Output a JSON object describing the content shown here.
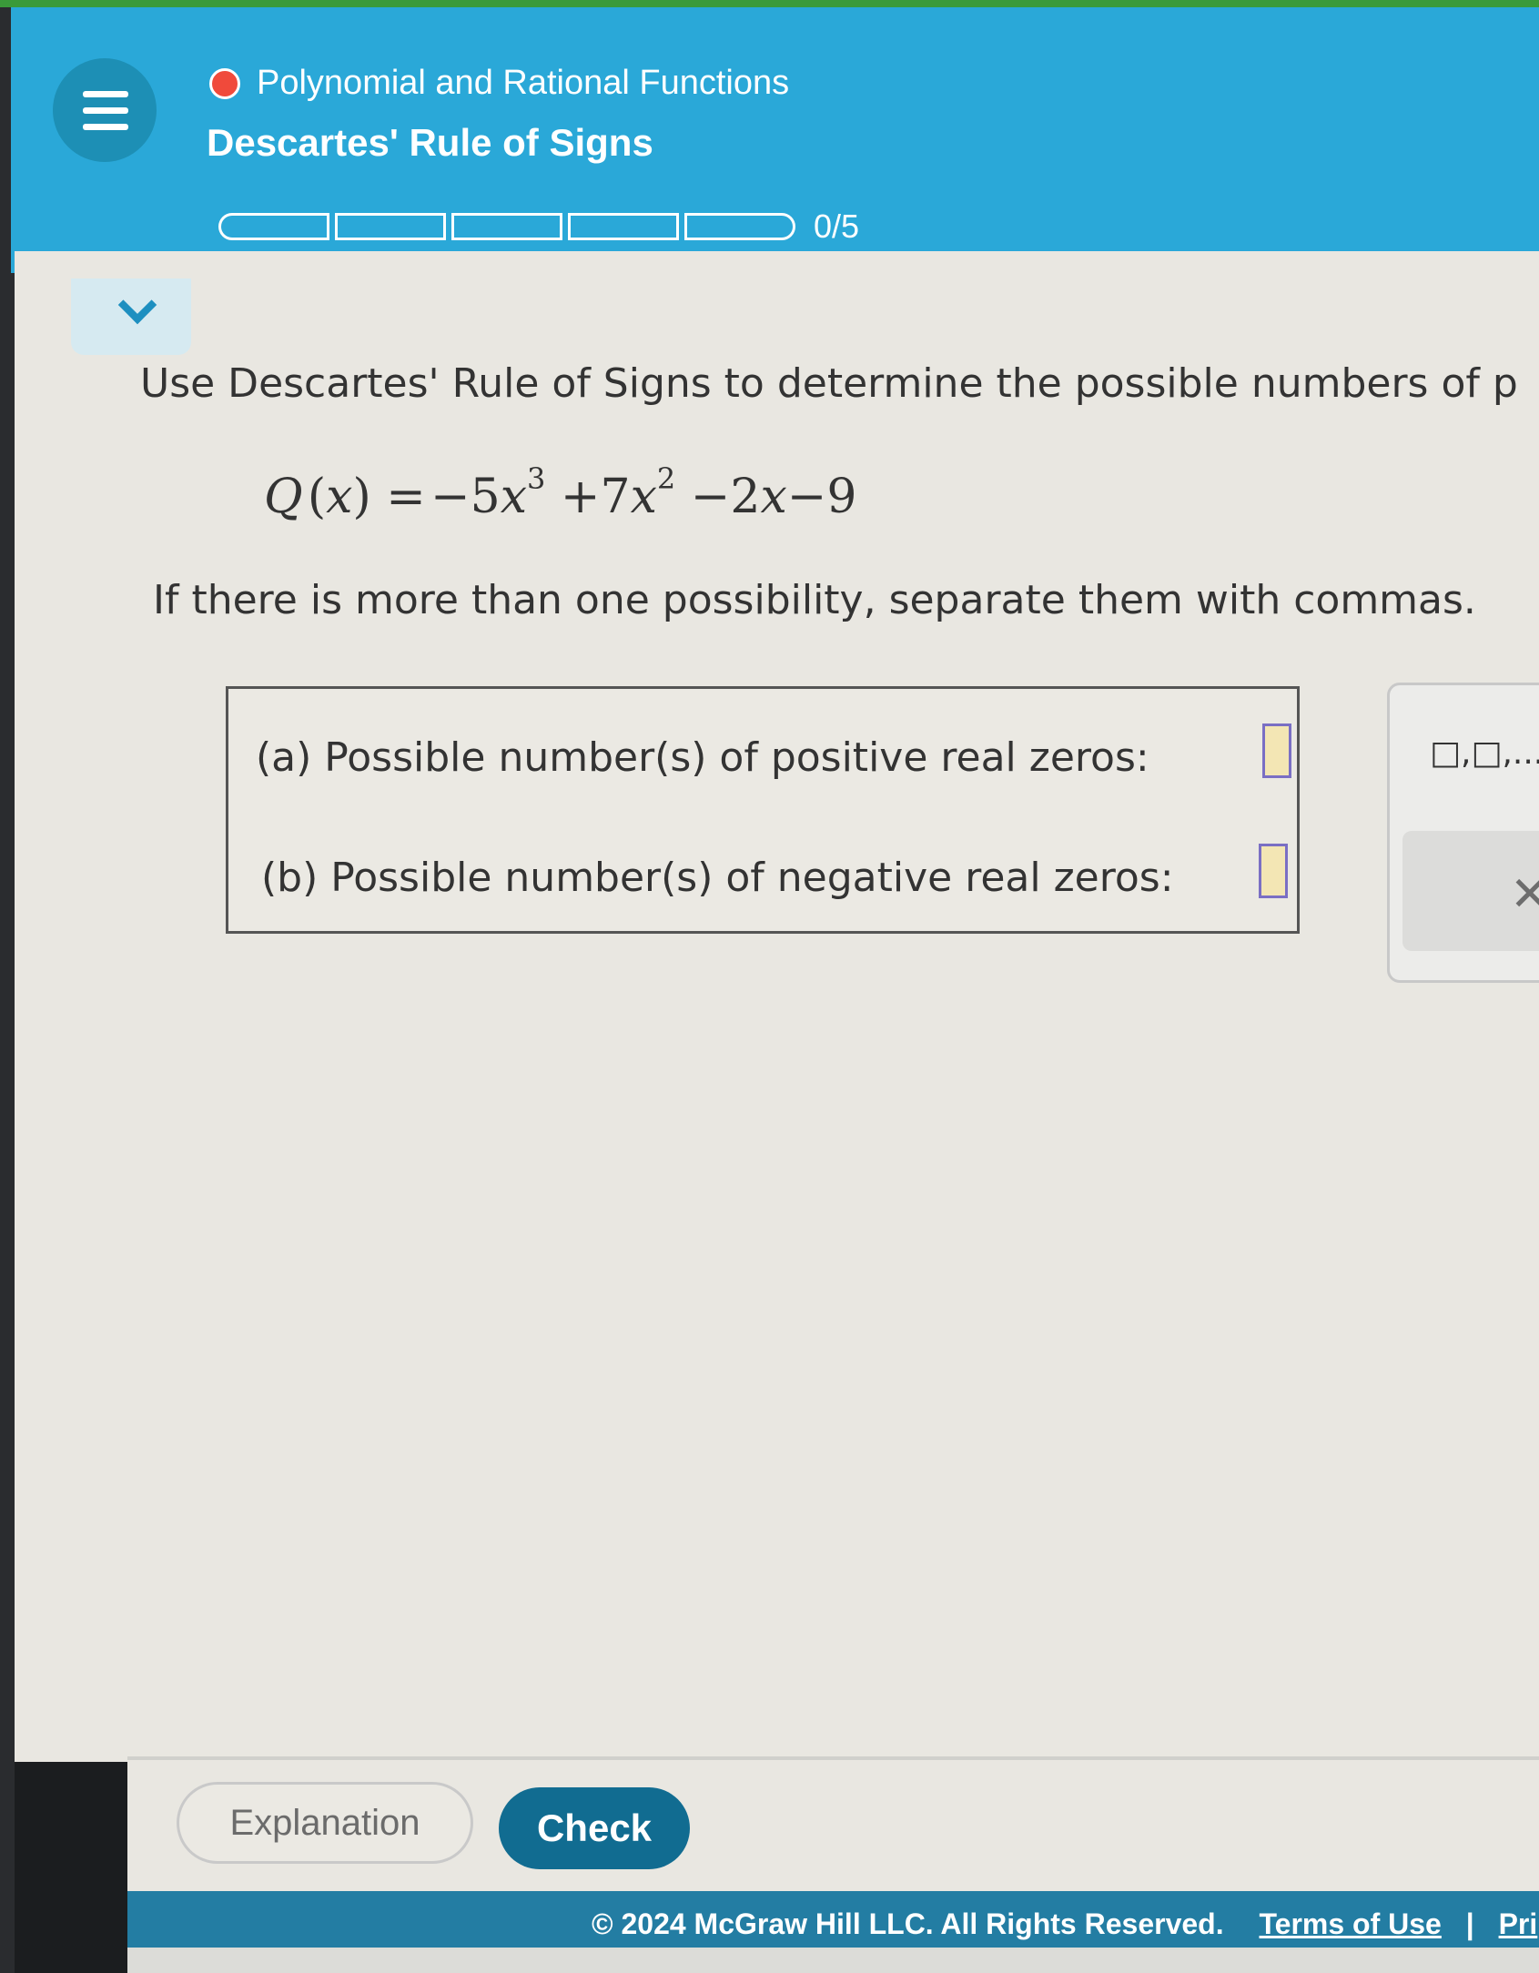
{
  "header": {
    "topic": "Polynomial and Rational Functions",
    "lesson_title": "Descartes' Rule of Signs",
    "progress_text": "0/5",
    "progress": {
      "completed": 0,
      "total": 5
    }
  },
  "question": {
    "instruction": "Use Descartes' Rule of Signs to determine the possible numbers of p",
    "equation": {
      "fname": "Q",
      "var": "x",
      "t1_sign": "−",
      "t1_coef": "5",
      "t1_var": "x",
      "t1_exp": "3",
      "t2_sign": "+",
      "t2_coef": "7",
      "t2_var": "x",
      "t2_exp": "2",
      "t3_sign": "−",
      "t3_coef": "2",
      "t3_var": "x",
      "t4_sign": "−",
      "t4_const": "9"
    },
    "separator_note": "If there is more than one possibility, separate them with commas.",
    "part_a_label": "(a) Possible number(s) of positive real zeros:",
    "part_b_label": "(b) Possible number(s) of negative real zeros:",
    "part_a_value": "",
    "part_b_value": ""
  },
  "palette": {
    "template_label": "□,□,...",
    "clear_icon": "close-icon"
  },
  "actions": {
    "explanation_label": "Explanation",
    "check_label": "Check"
  },
  "footer": {
    "copyright": "© 2024 McGraw Hill LLC. All Rights Reserved.",
    "terms": "Terms of Use",
    "privacy": "Pri"
  },
  "colors": {
    "header_bg": "#2aa8d8",
    "status_dot": "#f04a3b",
    "check_button": "#116c91",
    "input_fill": "#f3e6b4",
    "input_border": "#7a6fc4"
  }
}
